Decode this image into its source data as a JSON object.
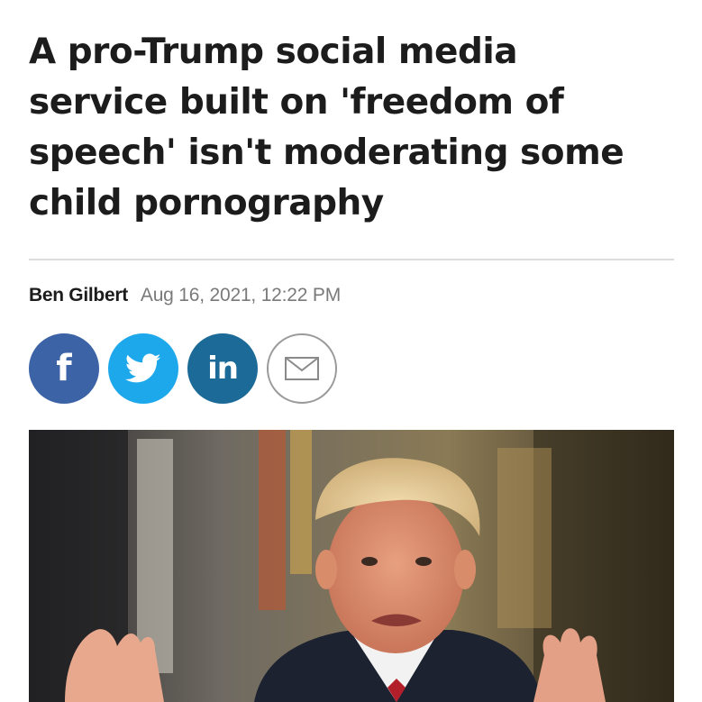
{
  "article": {
    "headline": "A pro-Trump social media service built on 'freedom of speech' isn't moderating some child pornography",
    "author": "Ben Gilbert",
    "date": "Aug 16, 2021, 12:22 PM"
  },
  "share": [
    {
      "network": "facebook",
      "icon": "facebook-icon",
      "color": "#3b63a6"
    },
    {
      "network": "twitter",
      "icon": "twitter-icon",
      "color": "#1da8ec"
    },
    {
      "network": "linkedin",
      "icon": "linkedin-icon",
      "color": "#1c6a97"
    },
    {
      "network": "email",
      "icon": "mail-icon",
      "color": "#9a9a9a"
    }
  ],
  "colors": {
    "text": "#1c1c1c",
    "meta_text": "#7a7a7a",
    "divider": "#dcdcdc"
  }
}
